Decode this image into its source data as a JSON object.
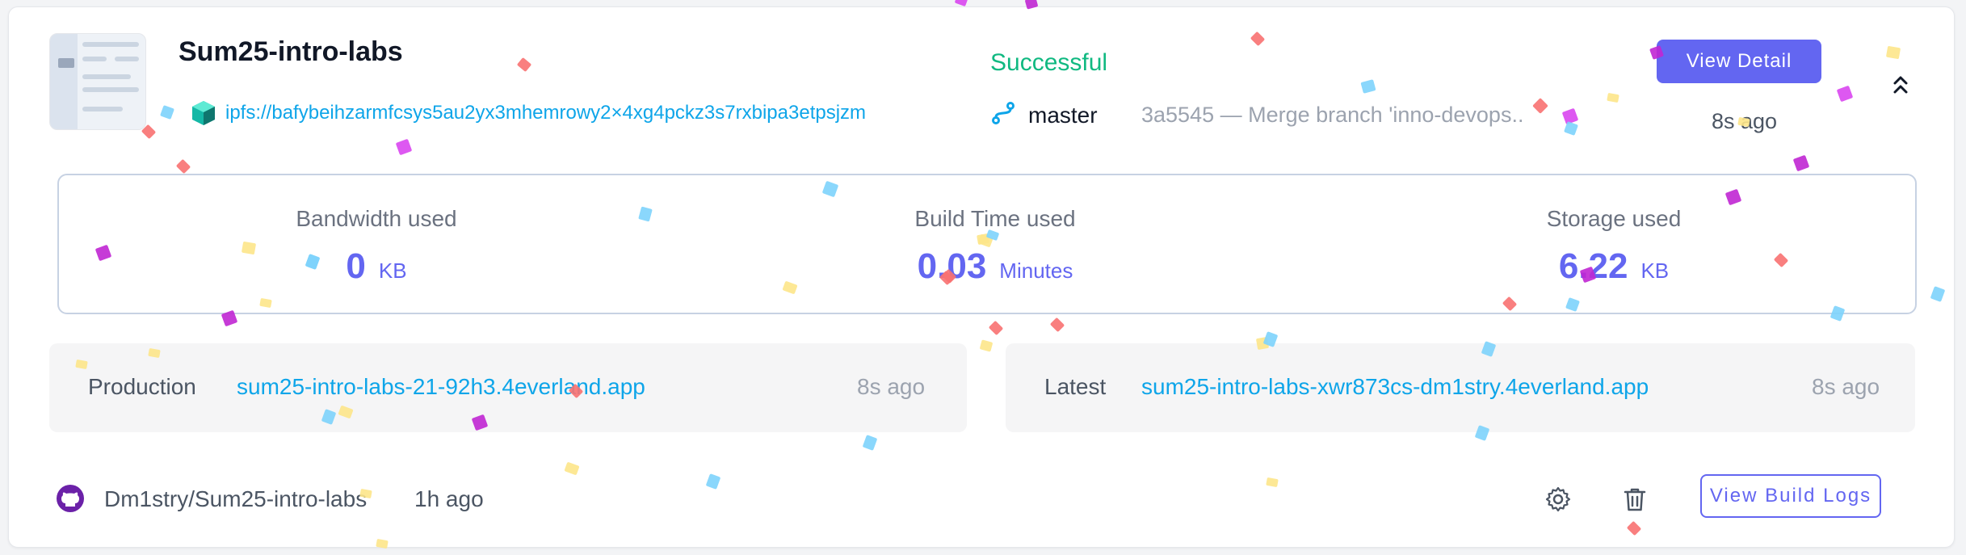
{
  "project": {
    "name": "Sum25-intro-labs",
    "ipfs_link": "ipfs://bafybeihzarmfcsys5au2yx3mhemrowy2×4xg4pckz3s7rxbipa3etpsjzm",
    "status": "Successful",
    "branch": "master",
    "commit": "3a5545 — Merge branch 'inno-devops..",
    "view_detail_label": "View Detail",
    "deploy_time": "8s ago"
  },
  "usage": {
    "bandwidth": {
      "label": "Bandwidth used",
      "value": "0",
      "unit": "KB"
    },
    "build_time": {
      "label": "Build Time used",
      "value": "0.03",
      "unit": "Minutes"
    },
    "storage": {
      "label": "Storage used",
      "value": "6.22",
      "unit": "KB"
    }
  },
  "domains": {
    "production": {
      "label": "Production",
      "url": "sum25-intro-labs-21-92h3.4everland.app",
      "time": "8s ago"
    },
    "latest": {
      "label": "Latest",
      "url": "sum25-intro-labs-xwr873cs-dm1stry.4everland.app",
      "time": "8s ago"
    }
  },
  "footer": {
    "repo": "Dm1stry/Sum25-intro-labs",
    "repo_time": "1h ago",
    "view_logs_label": "View Build Logs"
  },
  "icons": {
    "ipfs": "ipfs-cube-icon",
    "branch": "git-branch-icon",
    "collapse": "chevron-up-icon",
    "github": "github-icon",
    "settings": "gear-icon",
    "delete": "trash-icon"
  },
  "colors": {
    "accent": "#6366f1",
    "success": "#10b981",
    "link": "#0ea5e9",
    "confetti": [
      "#d946ef",
      "#f87171",
      "#7dd3fc",
      "#fde68a",
      "#c026d3"
    ]
  }
}
